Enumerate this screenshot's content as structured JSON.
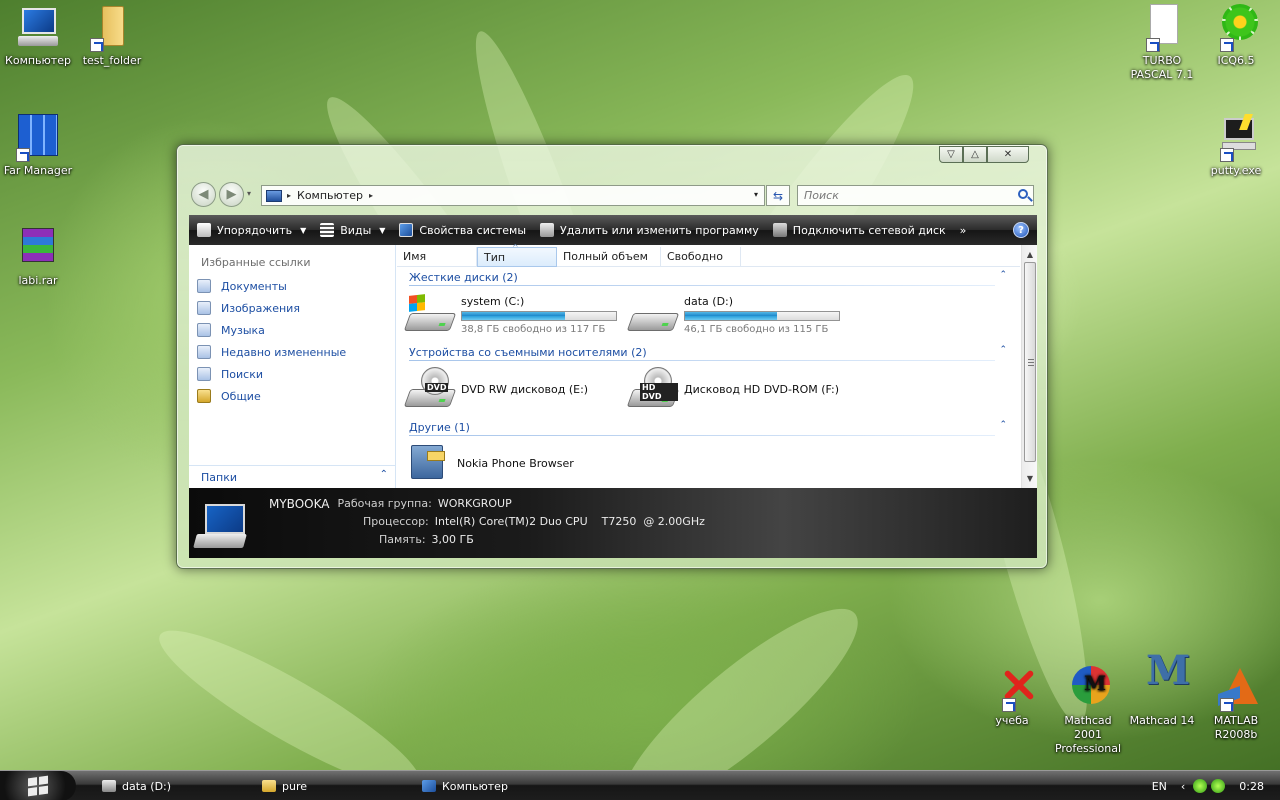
{
  "desktop": {
    "icons": [
      {
        "label": "Компьютер",
        "icon": "computer-icon"
      },
      {
        "label": "test_folder",
        "icon": "folder-icon"
      },
      {
        "label": "Far Manager",
        "icon": "far-manager-icon"
      },
      {
        "label": "labi.rar",
        "icon": "winrar-archive-icon"
      },
      {
        "label": "TURBO PASCAL 7.1",
        "icon": "document-shortcut-icon"
      },
      {
        "label": "ICQ6.5",
        "icon": "icq-flower-icon"
      },
      {
        "label": "putty.exe",
        "icon": "putty-icon"
      },
      {
        "label": "учеба",
        "icon": "red-x-shortcut-icon"
      },
      {
        "label": "Mathcad 2001 Professional",
        "icon": "mathcad-icon"
      },
      {
        "label": "Mathcad 14",
        "icon": "mathcad-m-icon"
      },
      {
        "label": "MATLAB R2008b",
        "icon": "matlab-icon"
      }
    ]
  },
  "window": {
    "caption_buttons": {
      "minimize": "▽",
      "maximize": "△",
      "close": "✕"
    },
    "nav": {
      "back": "◀",
      "forward": "▶",
      "recent": "▾"
    },
    "address": {
      "crumb": "Компьютер",
      "sep": "▸",
      "dropdown": "▾"
    },
    "refresh_glyph": "⇆",
    "search_placeholder": "Поиск",
    "toolbar": {
      "organize": "Упорядочить",
      "views": "Виды",
      "system_properties": "Свойства системы",
      "uninstall": "Удалить или изменить программу",
      "map_drive": "Подключить сетевой диск",
      "more": "»",
      "help": "?",
      "arrow": "▼"
    },
    "nav_pane": {
      "heading": "Избранные ссылки",
      "links": [
        "Документы",
        "Изображения",
        "Музыка",
        "Недавно измененные",
        "Поиски",
        "Общие"
      ],
      "folders_label": "Папки",
      "folders_chevron": "⌃"
    },
    "columns": [
      "Имя",
      "Тип",
      "Полный объем",
      "Свободно"
    ],
    "sort_arrow": "^",
    "groups": {
      "hard_disks": "Жесткие диски (2)",
      "removable": "Устройства со съемными носителями (2)",
      "other": "Другие (1)",
      "chevron": "⌃"
    },
    "drives": {
      "c": {
        "name": "system (C:)",
        "free": "38,8 ГБ свободно из 117 ГБ",
        "used_fraction": 0.67
      },
      "d": {
        "name": "data (D:)",
        "free": "46,1 ГБ свободно из 115 ГБ",
        "used_fraction": 0.6
      },
      "e": {
        "name": "DVD RW дисковод (E:)",
        "badge": "DVD"
      },
      "f": {
        "name": "Дисковод HD DVD-ROM (F:)",
        "badge": "HD DVD"
      },
      "nokia": {
        "name": "Nokia Phone Browser"
      }
    },
    "scrollbar": {
      "up": "▲",
      "down": "▼"
    },
    "details": {
      "computer_name": "MYBOOKA",
      "workgroup_label": "Рабочая группа:",
      "workgroup": "WORKGROUP",
      "cpu_label": "Процессор:",
      "cpu": "Intel(R) Core(TM)2 Duo CPU    T7250  @ 2.00GHz",
      "ram_label": "Память:",
      "ram": "3,00 ГБ"
    }
  },
  "taskbar": {
    "tasks": [
      {
        "label": "data (D:)",
        "icon": "drive-icon"
      },
      {
        "label": "pure",
        "icon": "folder-icon"
      },
      {
        "label": "Компьютер",
        "icon": "computer-icon"
      }
    ],
    "tray": {
      "lang": "EN",
      "chevron": "‹",
      "clock": "0:28"
    }
  },
  "colors": {
    "accent_link": "#1e4fa3",
    "drive_bar": "#1c86c9",
    "toolbar_bg": "#2b2b2b"
  }
}
